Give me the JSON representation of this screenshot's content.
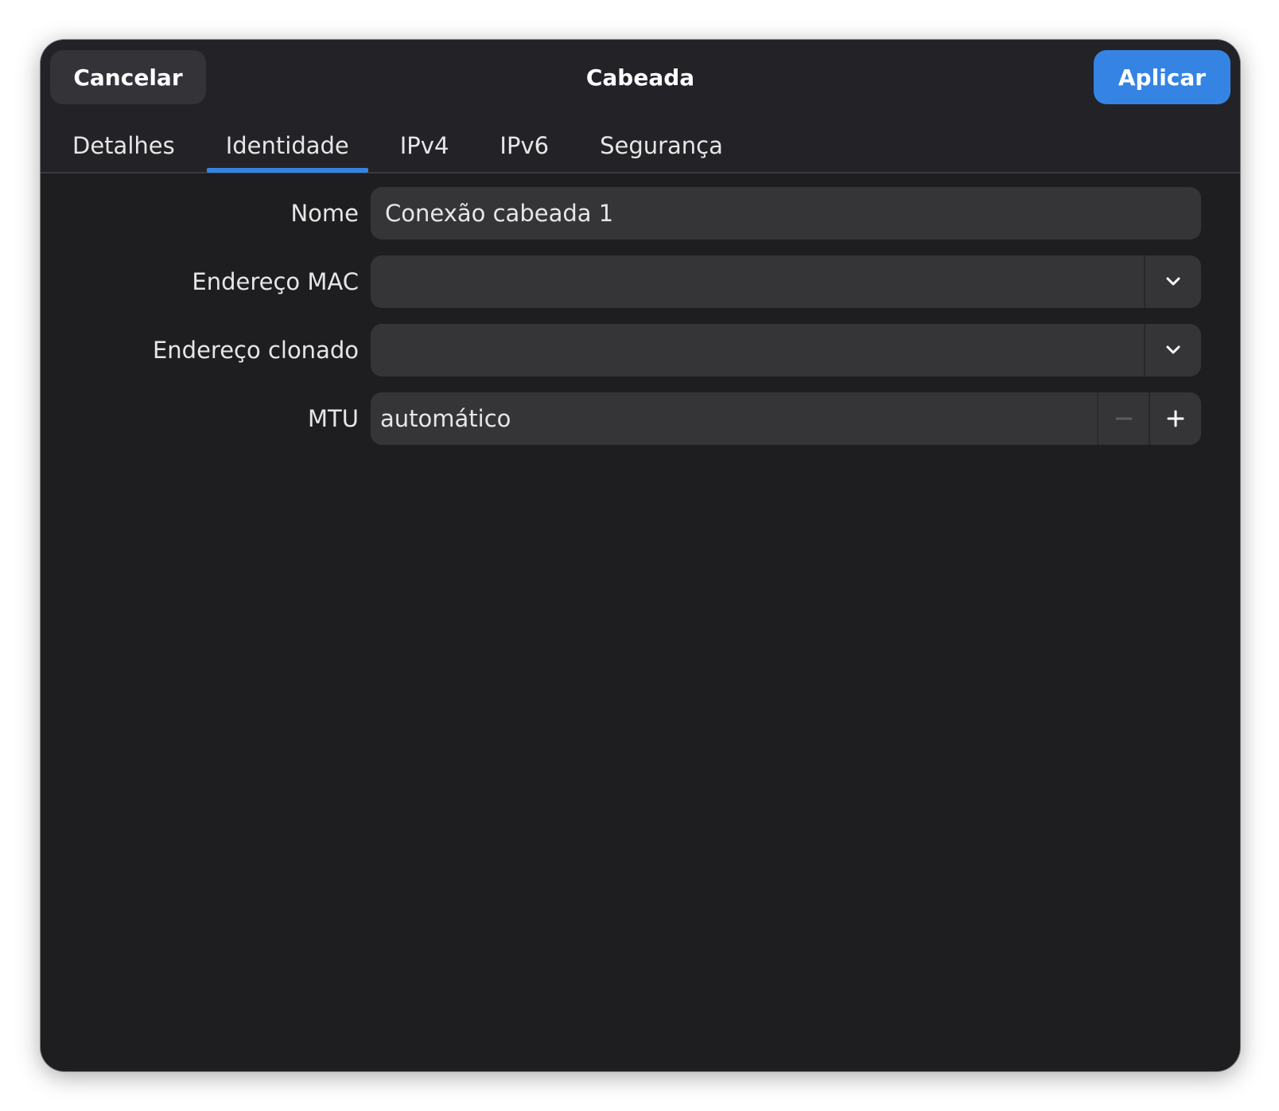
{
  "header": {
    "title": "Cabeada",
    "cancel_label": "Cancelar",
    "apply_label": "Aplicar"
  },
  "tabs": [
    {
      "label": "Detalhes",
      "active": false
    },
    {
      "label": "Identidade",
      "active": true
    },
    {
      "label": "IPv4",
      "active": false
    },
    {
      "label": "IPv6",
      "active": false
    },
    {
      "label": "Segurança",
      "active": false
    }
  ],
  "form": {
    "name": {
      "label": "Nome",
      "value": "Conexão cabeada 1"
    },
    "mac_address": {
      "label": "Endereço MAC",
      "value": "",
      "icon": "chevron-down-icon"
    },
    "cloned_address": {
      "label": "Endereço clonado",
      "value": "",
      "icon": "chevron-down-icon"
    },
    "mtu": {
      "label": "MTU",
      "value": "automático",
      "minus_icon": "minus-icon",
      "plus_icon": "plus-icon",
      "minus_enabled": false
    }
  },
  "colors": {
    "accent": "#3584e4",
    "dialog_bg": "#1e1e20",
    "header_bg": "#232327",
    "field_bg": "#353538",
    "text": "#e6e6e6"
  }
}
